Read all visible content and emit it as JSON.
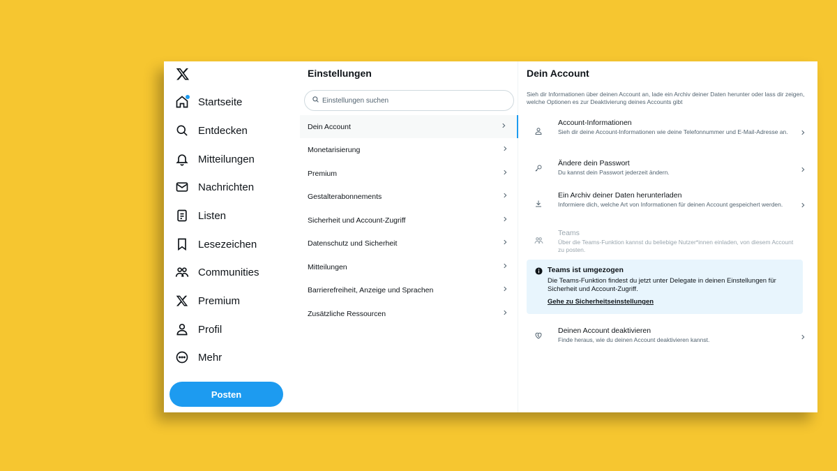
{
  "nav": {
    "items": [
      {
        "label": "Startseite",
        "icon": "home-icon"
      },
      {
        "label": "Entdecken",
        "icon": "search-icon"
      },
      {
        "label": "Mitteilungen",
        "icon": "bell-icon"
      },
      {
        "label": "Nachrichten",
        "icon": "mail-icon"
      },
      {
        "label": "Listen",
        "icon": "list-icon"
      },
      {
        "label": "Lesezeichen",
        "icon": "bookmark-icon"
      },
      {
        "label": "Communities",
        "icon": "communities-icon"
      },
      {
        "label": "Premium",
        "icon": "x-logo-icon"
      },
      {
        "label": "Profil",
        "icon": "user-icon"
      },
      {
        "label": "Mehr",
        "icon": "more-icon"
      }
    ],
    "post_label": "Posten"
  },
  "settings": {
    "title": "Einstellungen",
    "search_placeholder": "Einstellungen suchen",
    "items": [
      {
        "label": "Dein Account",
        "active": true
      },
      {
        "label": "Monetarisierung"
      },
      {
        "label": "Premium"
      },
      {
        "label": "Gestalterabonnements"
      },
      {
        "label": "Sicherheit und Account-Zugriff"
      },
      {
        "label": "Datenschutz und Sicherheit"
      },
      {
        "label": "Mitteilungen"
      },
      {
        "label": "Barrierefreiheit, Anzeige und Sprachen"
      },
      {
        "label": "Zusätzliche Ressourcen"
      }
    ]
  },
  "account": {
    "title": "Dein Account",
    "description": "Sieh dir Informationen über deinen Account an, lade ein Archiv deiner Daten herunter oder lass dir zeigen, welche Optionen es zur Deaktivierung deines Accounts gibt",
    "items": [
      {
        "title": "Account-Informationen",
        "subtitle": "Sieh dir deine Account-Informationen wie deine Telefonnummer und E-Mail-Adresse an.",
        "icon": "user-icon"
      },
      {
        "title": "Ändere dein Passwort",
        "subtitle": "Du kannst dein Passwort jederzeit ändern.",
        "icon": "key-icon"
      },
      {
        "title": "Ein Archiv deiner Daten herunterladen",
        "subtitle": "Informiere dich, welche Art von Informationen für deinen Account gespeichert werden.",
        "icon": "download-icon"
      },
      {
        "title": "Teams",
        "subtitle": "Über die Teams-Funktion kannst du beliebige Nutzer*innen einladen, von diesem Account zu posten.",
        "icon": "teams-icon"
      }
    ],
    "notice": {
      "title": "Teams ist umgezogen",
      "body": "Die Teams-Funktion findest du jetzt unter Delegate in deinen Einstellungen für Sicherheit und Account-Zugriff.",
      "link": "Gehe zu Sicherheitseinstellungen"
    },
    "deactivate": {
      "title": "Deinen Account deaktivieren",
      "subtitle": "Finde heraus, wie du deinen Account deaktivieren kannst.",
      "icon": "broken-heart-icon"
    }
  },
  "colors": {
    "background": "#f6c630",
    "accent": "#1d9bf0",
    "notice_bg": "#e8f5fd"
  }
}
